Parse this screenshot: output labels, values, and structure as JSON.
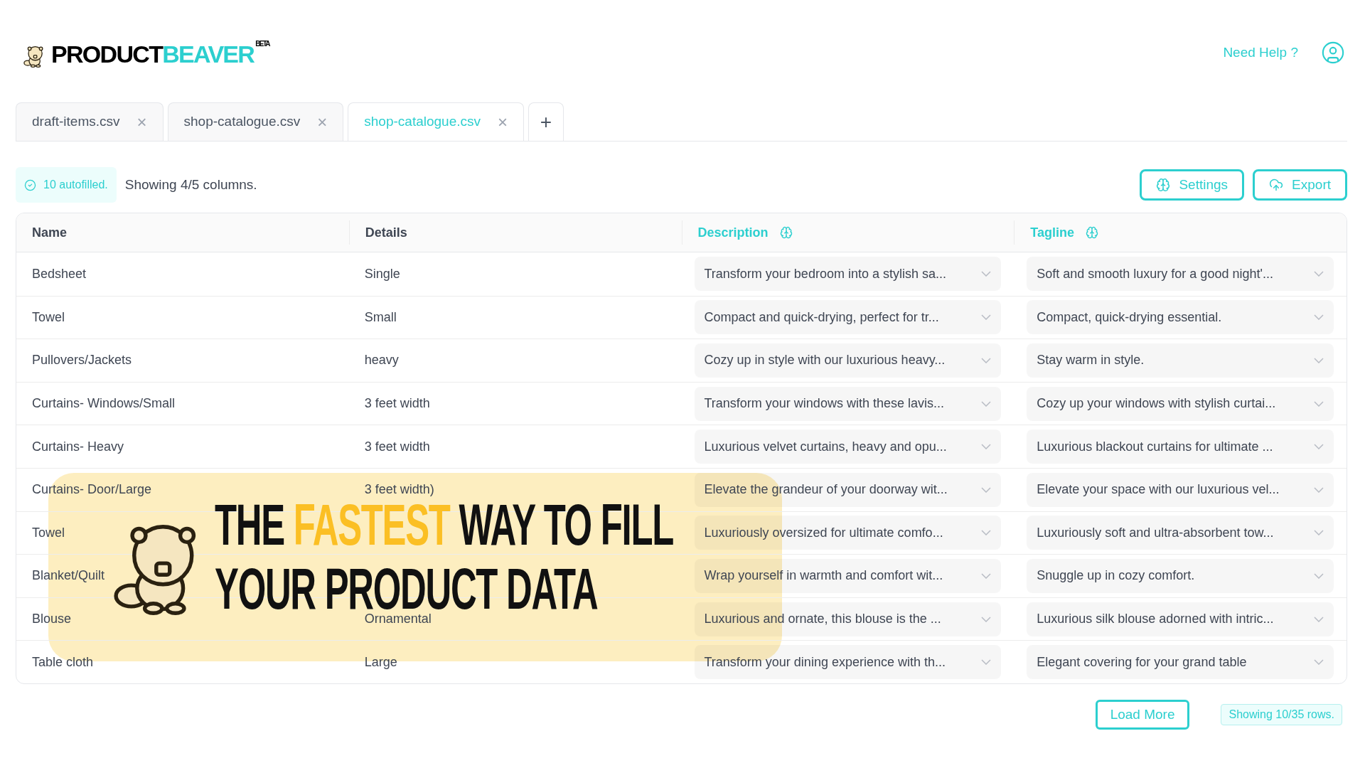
{
  "logo": {
    "part_1": "PRODUCT",
    "part_2": "BEAVER",
    "badge": "BETA"
  },
  "header": {
    "help_link": "Need Help ?"
  },
  "tabs": [
    {
      "label": "draft-items.csv",
      "close": "×",
      "selected": false
    },
    {
      "label": "shop-catalogue.csv",
      "close": "×",
      "selected": false
    },
    {
      "label": "shop-catalogue.csv",
      "close": "×",
      "selected": true
    }
  ],
  "new_tab": "+",
  "toolbar": {
    "autofilled": "10 autofilled.",
    "columns_note": "Showing 4/5 columns.",
    "buttons": [
      {
        "kind": "settings",
        "label": "Settings"
      },
      {
        "kind": "export",
        "label": "Export"
      }
    ]
  },
  "table": {
    "columns": [
      {
        "label": "Name",
        "autofill": false
      },
      {
        "label": "Details",
        "autofill": false
      },
      {
        "label": "Description",
        "autofill": true
      },
      {
        "label": "Tagline",
        "autofill": true
      }
    ],
    "rows": [
      {
        "name": "Bedsheet",
        "details": "Single",
        "description": "Transform your bedroom into a stylish sa...",
        "tagline": "Soft and smooth luxury for a good night'..."
      },
      {
        "name": "Towel",
        "details": "Small",
        "description": "Compact and quick-drying, perfect for tr...",
        "tagline": "Compact, quick-drying essential."
      },
      {
        "name": "Pullovers/Jackets",
        "details": "heavy",
        "description": "Cozy up in style with our luxurious heavy...",
        "tagline": "Stay warm in style."
      },
      {
        "name": "Curtains- Windows/Small",
        "details": "3 feet width",
        "description": "Transform your windows with these lavis...",
        "tagline": "Cozy up your windows with stylish curtai..."
      },
      {
        "name": "Curtains- Heavy",
        "details": "3 feet width",
        "description": "Luxurious velvet curtains, heavy and opu...",
        "tagline": "Luxurious blackout curtains for ultimate ..."
      },
      {
        "name": "Curtains- Door/Large",
        "details": "3 feet width)",
        "description": "Elevate the grandeur of your doorway wit...",
        "tagline": "Elevate your space with our luxurious vel..."
      },
      {
        "name": "Towel",
        "description": "Luxuriously oversized for ultimate comfo...",
        "tagline": "Luxuriously soft and ultra-absorbent tow..."
      },
      {
        "name": "Blanket/Quilt",
        "description": "Wrap yourself in warmth and comfort wit...",
        "tagline": "Snuggle up in cozy comfort."
      },
      {
        "name": "Blouse",
        "details": "Ornamental",
        "description": "Luxurious and ornate, this blouse is the ...",
        "tagline": "Luxurious silk blouse adorned with intric..."
      },
      {
        "name": "Table cloth",
        "details": "Large",
        "description": "Transform your dining experience with th...",
        "tagline": "Elegant covering for your grand table"
      }
    ]
  },
  "footer": {
    "load_more": "Load More",
    "rows_note": "Showing 10/35 rows."
  },
  "banner": {
    "lines": [
      [
        {
          "text": "THE",
          "accent": false
        },
        {
          "text": "FASTEST",
          "accent": true
        },
        {
          "text": "WAY TO FILL",
          "accent": false
        }
      ],
      [
        {
          "text": "YOUR PRODUCT DATA",
          "accent": false
        }
      ]
    ]
  }
}
